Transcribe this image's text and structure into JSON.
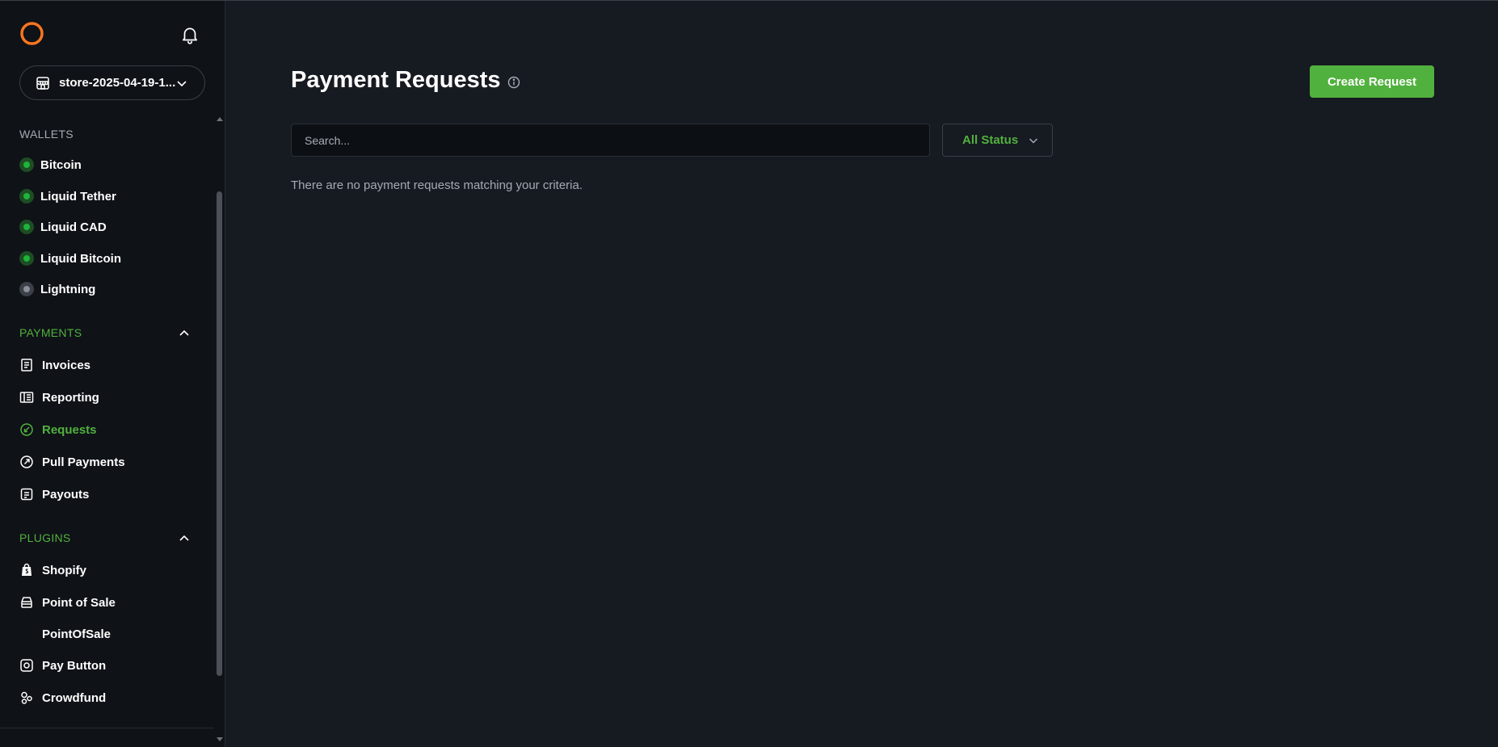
{
  "store": {
    "name": "store-2025-04-19-1..."
  },
  "sidebar": {
    "wallets_header": "WALLETS",
    "wallets": [
      {
        "label": "Bitcoin",
        "status": "on"
      },
      {
        "label": "Liquid Tether",
        "status": "on"
      },
      {
        "label": "Liquid CAD",
        "status": "on"
      },
      {
        "label": "Liquid Bitcoin",
        "status": "on"
      },
      {
        "label": "Lightning",
        "status": "off"
      }
    ],
    "payments_header": "PAYMENTS",
    "payments": [
      {
        "label": "Invoices",
        "icon": "invoice-icon"
      },
      {
        "label": "Reporting",
        "icon": "reporting-icon"
      },
      {
        "label": "Requests",
        "icon": "requests-icon",
        "active": true
      },
      {
        "label": "Pull Payments",
        "icon": "pull-payments-icon"
      },
      {
        "label": "Payouts",
        "icon": "payouts-icon"
      }
    ],
    "plugins_header": "PLUGINS",
    "plugins": [
      {
        "label": "Shopify",
        "icon": "shopify-icon"
      },
      {
        "label": "Point of Sale",
        "icon": "point-of-sale-icon"
      },
      {
        "label": "PointOfSale",
        "icon": ""
      },
      {
        "label": "Pay Button",
        "icon": "pay-button-icon"
      },
      {
        "label": "Crowdfund",
        "icon": "crowdfund-icon"
      }
    ]
  },
  "main": {
    "title": "Payment Requests",
    "create_button": "Create Request",
    "search_placeholder": "Search...",
    "status_filter": "All Status",
    "empty_message": "There are no payment requests matching your criteria."
  },
  "colors": {
    "accent": "#51b13e",
    "brand": "#f7761f",
    "background": "#161a21",
    "sidebar": "#0f1217"
  }
}
